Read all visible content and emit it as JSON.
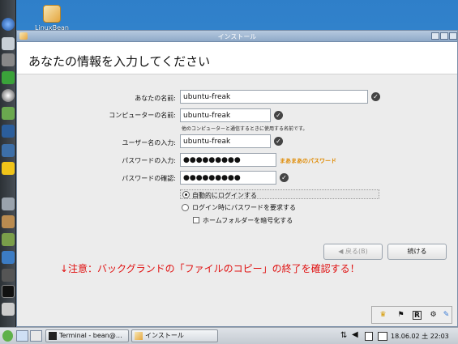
{
  "desktop": {
    "icon_label": "LinuxBean"
  },
  "window": {
    "title": "インストール",
    "header": "あなたの情報を入力してください"
  },
  "form": {
    "name_label": "あなたの名前:",
    "name_value": "ubuntu-freak",
    "computer_label": "コンピューターの名前:",
    "computer_value": "ubuntu-freak",
    "computer_hint": "他のコンピューターと通信するときに使用する名前です。",
    "user_label": "ユーザー名の入力:",
    "user_value": "ubuntu-freak",
    "password_label": "パスワードの入力:",
    "password_value": "●●●●●●●●●",
    "password_strength": "まあまあのパスワード",
    "confirm_label": "パスワードの確認:",
    "confirm_value": "●●●●●●●●●",
    "auto_login": "自動的にログインする",
    "require_password": "ログイン時にパスワードを要求する",
    "encrypt_home": "ホームフォルダーを暗号化する"
  },
  "buttons": {
    "back": "◀ 戻る(B)",
    "continue": "続ける"
  },
  "note": "↓注意：バックグランドの「ファイルのコピー」の終了を確認する！",
  "taskbar": {
    "terminal": "Terminal - bean@…",
    "install": "インストール",
    "clock": "18.06.02 土 22:03"
  },
  "colors": {
    "accent": "#2f7fc9",
    "note": "#e01010",
    "strength": "#e08a00"
  }
}
